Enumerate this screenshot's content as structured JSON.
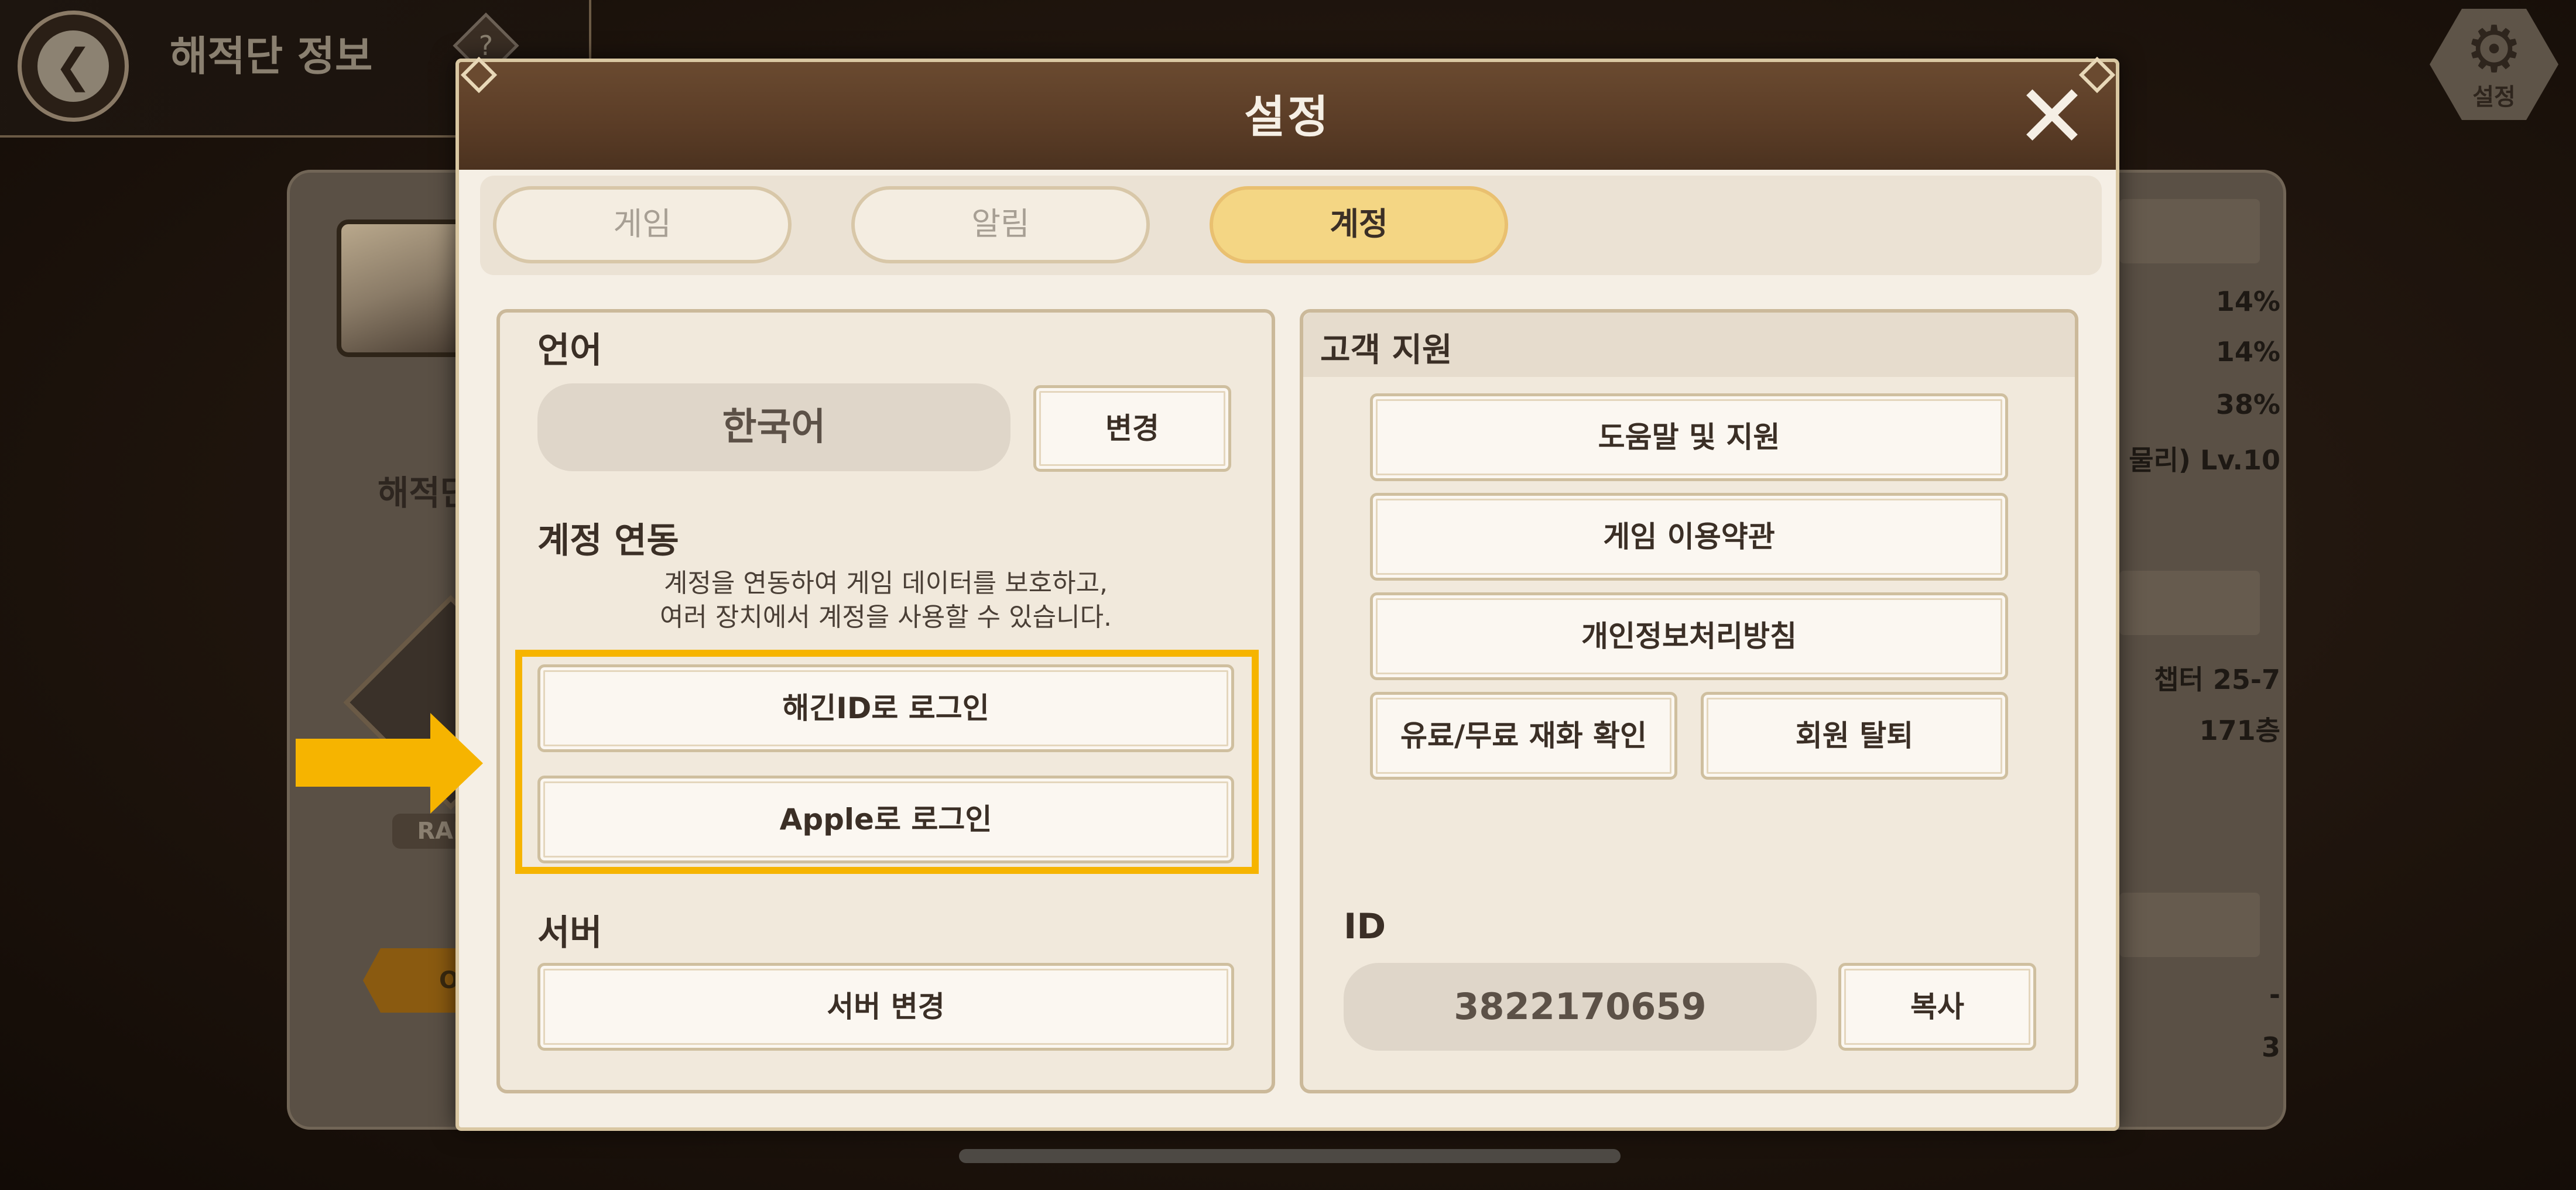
{
  "background": {
    "page_title": "해적단 정보",
    "help_icon_label": "?",
    "settings_button_label": "설정",
    "player_card_name": "해적단",
    "rank_label": "RAN",
    "orange_button_label": "O",
    "stats": [
      "14%",
      "14%",
      "38%",
      "물리) Lv.10",
      "챕터 25-7",
      "171층",
      "-",
      "3"
    ]
  },
  "dialog": {
    "title": "설정",
    "tabs": [
      {
        "label": "게임",
        "active": false
      },
      {
        "label": "알림",
        "active": false
      },
      {
        "label": "계정",
        "active": true
      }
    ],
    "left": {
      "language": {
        "title": "언어",
        "value": "한국어",
        "change_label": "변경"
      },
      "account_link": {
        "title": "계정 연동",
        "description_line1": "계정을 연동하여 게임 데이터를 보호하고,",
        "description_line2": "여러 장치에서 계정을 사용할 수 있습니다.",
        "buttons": [
          "해긴ID로 로그인",
          "Apple로 로그인"
        ]
      },
      "server": {
        "title": "서버",
        "change_label": "서버 변경"
      }
    },
    "right": {
      "support_title": "고객 지원",
      "buttons": [
        "도움말 및 지원",
        "게임 이용약관",
        "개인정보처리방침"
      ],
      "small_buttons": [
        "유료/무료 재화 확인",
        "회원 탈퇴"
      ],
      "id_title": "ID",
      "id_value": "3822170659",
      "copy_label": "복사"
    }
  },
  "colors": {
    "header_brown": "#5a3c26",
    "active_tab": "#f4d684",
    "highlight": "#f6b400",
    "panel_bg": "#f1e9dc"
  }
}
